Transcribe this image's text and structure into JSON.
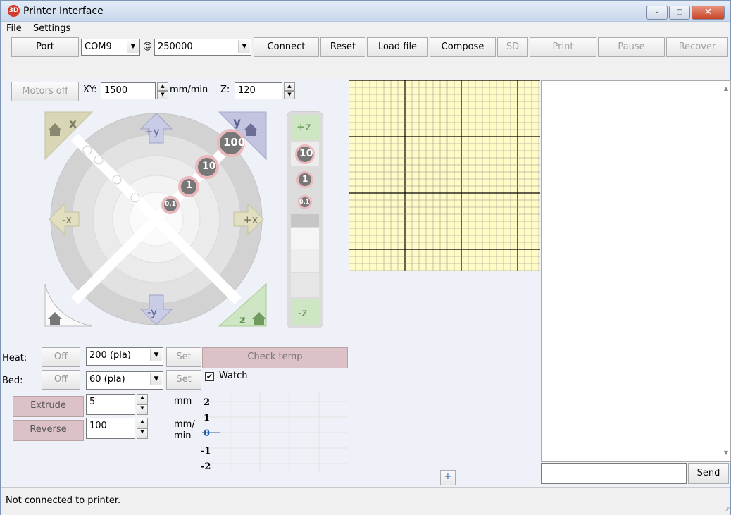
{
  "window": {
    "title": "Printer Interface",
    "minimize": "–",
    "maximize": "□",
    "close": "✕",
    "app_icon": "printrun-logo"
  },
  "menubar": {
    "file": "File",
    "settings": "Settings"
  },
  "toolbar": {
    "port_label": "Port",
    "port_value": "COM9",
    "at_label": "@",
    "baud_value": "250000",
    "connect": "Connect",
    "reset": "Reset",
    "load_file": "Load file",
    "compose": "Compose",
    "sd": "SD",
    "print": "Print",
    "pause": "Pause",
    "recover": "Recover",
    "motors_off": "Motors off",
    "xy_label": "XY:",
    "xy_value": "1500",
    "mm_min_label": "mm/min",
    "z_label": "Z:",
    "z_value": "120"
  },
  "jog": {
    "home_x": "x",
    "home_y": "y",
    "plus_y": "+y",
    "minus_y": "-y",
    "plus_x": "+x",
    "minus_x": "-x",
    "home_z": "z",
    "step_100": "100",
    "step_10": "10",
    "step_1": "1",
    "step_01": "0.1",
    "plus_z": "+z",
    "minus_z": "-z",
    "z_step_10": "10",
    "z_step_1": "1",
    "z_step_01": "0.1"
  },
  "temp": {
    "heat_label": "Heat:",
    "heat_off": "Off",
    "heat_value": "200 (pla)",
    "heat_set": "Set",
    "check_temp": "Check temp",
    "bed_label": "Bed:",
    "bed_off": "Off",
    "bed_value": "60 (pla)",
    "bed_set": "Set",
    "watch": "Watch",
    "graph_ticks": [
      "2",
      "1",
      "0",
      "-1",
      "-2"
    ]
  },
  "extrude": {
    "extrude": "Extrude",
    "extrude_value": "5",
    "mm": "mm",
    "reverse": "Reverse",
    "reverse_value": "100",
    "mm_min_1": "mm/",
    "mm_min_2": "min"
  },
  "plater": {
    "add": "+"
  },
  "console": {
    "send": "Send",
    "input_value": ""
  },
  "status": {
    "text": "Not connected to printer."
  },
  "colors": {
    "grid_bg": "#fffbc7",
    "accent_pink": "#dcc2c6",
    "window_bg": "#eef1f7"
  }
}
